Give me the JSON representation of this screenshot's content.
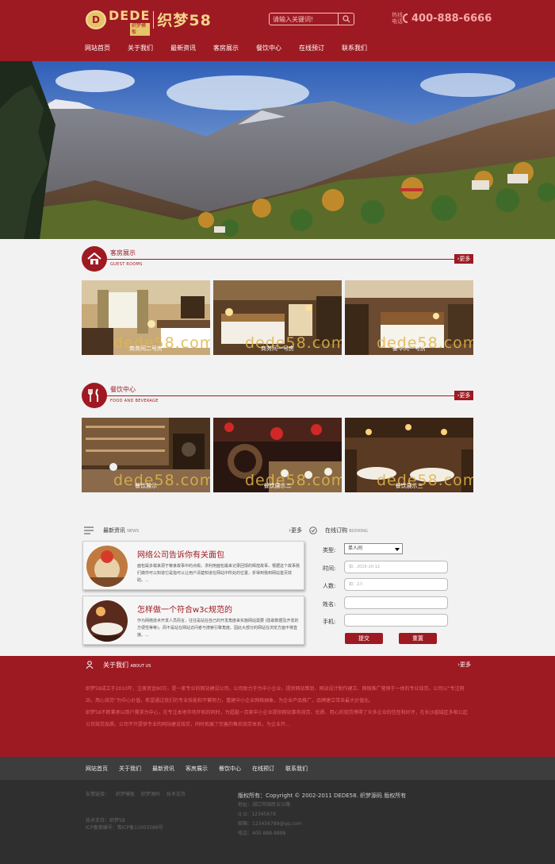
{
  "header": {
    "logo_badge": "D",
    "logo_en": "DEDE",
    "logo_sub": "织梦模板",
    "logo_cn": "织梦58",
    "search_placeholder": "请输入关键词!",
    "hotline_label": "热线电话",
    "hotline_number": "400-888-6666"
  },
  "nav": [
    "网站首页",
    "关于我们",
    "最新资讯",
    "客房展示",
    "餐饮中心",
    "在线预订",
    "联系我们"
  ],
  "rooms": {
    "title": "客房展示",
    "subtitle": "GUEST ROOMS",
    "more": "更多",
    "items": [
      {
        "caption": "商务间二号房",
        "watermark": "dede58.com"
      },
      {
        "caption": "商务间一号房",
        "watermark": "dede58.com"
      },
      {
        "caption": "豪华间一号房",
        "watermark": "dede58.com"
      }
    ]
  },
  "food": {
    "title": "餐饮中心",
    "subtitle": "FOOD AND BEVERAGE",
    "more": "更多",
    "items": [
      {
        "caption": "餐饮展示",
        "watermark": "dede58.com"
      },
      {
        "caption": "餐饮展示二",
        "watermark": "dede58.com"
      },
      {
        "caption": "餐饮展示三",
        "watermark": "dede58.com"
      }
    ]
  },
  "news": {
    "title": "最新资讯",
    "subtitle": "NEWS",
    "more": "更多",
    "items": [
      {
        "title": "网络公司告诉你有关面包",
        "desc": "面包属多载来源于粮食故事中的点缀，求利用面包最来记录回馈的辉煌故事，根据这个故事我们做你可以知道它是指可以让用户清楚知道在网站中所处的位置，折得到我到网站首页效助。..."
      },
      {
        "title": "怎样做一个符合w3c规范的",
        "desc": "作为网络技术开发人员而言，往往是站在自己的开发角度来实施网站需要 (隐歌数据及开发的方便性等等)，而不是站在网站访问者与搜索引擎角度。因此大部分的网站在浏览方面不够直接。..."
      }
    ]
  },
  "booking": {
    "title": "在线订购",
    "subtitle": "BOOKING",
    "fields": [
      {
        "label": "类型:",
        "value": "单人间"
      },
      {
        "label": "时间:",
        "placeholder": "如：2015-10-12"
      },
      {
        "label": "人数:",
        "placeholder": "如：2人"
      },
      {
        "label": "姓名:",
        "placeholder": ""
      },
      {
        "label": "手机:",
        "placeholder": ""
      }
    ],
    "submit": "提交",
    "reset": "重置"
  },
  "about": {
    "title": "关于我们",
    "subtitle": "ABOUT US",
    "more": "更多",
    "para1": "织梦58成立于2010年，注册资金80万，是一家专业的网站建设公司。公司致力于为中小企业，提供网站策划、网站设计制作建立、网络推广营销于一体的专业效劳。公司以“专注网站，用心效劳”为中心价值，希望通过我们的专业技能和不懈努力，重建中小企业网络抽象，为企业产品推广，品牌建立带去最大价值化。",
    "para2": "织梦58不断秉承以用户需求为中心，在专注本地市场开拓的同时，为超越一百家中小企业提供网站事务效劳、优质、用心的效劳博得了众多企业的信任和好评，在长沙越城区多相公起公司效劳品质。公司不只提供专业的网站建设效劳，同时拓展了完善的售后效劳体系，为企业开..."
  },
  "footer_nav": [
    "网站首页",
    "关于我们",
    "最新资讯",
    "客房展示",
    "餐饮中心",
    "在线预订",
    "联系我们"
  ],
  "footer": {
    "links_label": "友情链接：",
    "links": [
      "织梦模板",
      "织梦源码",
      "技术支持"
    ],
    "support": "技术支持：织梦58",
    "icp": "ICP备案编号：粤ICP备11003588号",
    "copyright": "版权所有：Copyright © 2002-2011 DEDE58. 织梦源码 版权所有",
    "address": "地址：湖口市国民五沙路",
    "qq": "Q Q：12345678",
    "email": "邮箱：123456789@qq.com",
    "phone": "电话：400-888-8888"
  },
  "colors": {
    "brand": "#9e1a22",
    "gold": "#e7c36a"
  }
}
